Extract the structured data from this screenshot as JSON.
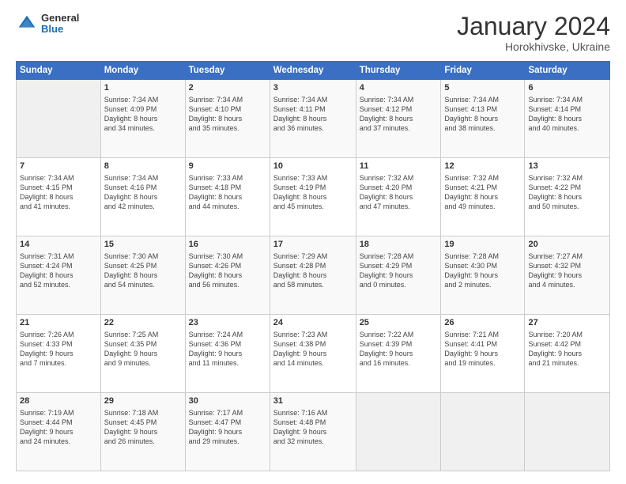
{
  "header": {
    "logo_line1": "General",
    "logo_line2": "Blue",
    "month": "January 2024",
    "location": "Horokhivske, Ukraine"
  },
  "days_of_week": [
    "Sunday",
    "Monday",
    "Tuesday",
    "Wednesday",
    "Thursday",
    "Friday",
    "Saturday"
  ],
  "weeks": [
    [
      {
        "day": "",
        "info": ""
      },
      {
        "day": "1",
        "info": "Sunrise: 7:34 AM\nSunset: 4:09 PM\nDaylight: 8 hours\nand 34 minutes."
      },
      {
        "day": "2",
        "info": "Sunrise: 7:34 AM\nSunset: 4:10 PM\nDaylight: 8 hours\nand 35 minutes."
      },
      {
        "day": "3",
        "info": "Sunrise: 7:34 AM\nSunset: 4:11 PM\nDaylight: 8 hours\nand 36 minutes."
      },
      {
        "day": "4",
        "info": "Sunrise: 7:34 AM\nSunset: 4:12 PM\nDaylight: 8 hours\nand 37 minutes."
      },
      {
        "day": "5",
        "info": "Sunrise: 7:34 AM\nSunset: 4:13 PM\nDaylight: 8 hours\nand 38 minutes."
      },
      {
        "day": "6",
        "info": "Sunrise: 7:34 AM\nSunset: 4:14 PM\nDaylight: 8 hours\nand 40 minutes."
      }
    ],
    [
      {
        "day": "7",
        "info": "Sunrise: 7:34 AM\nSunset: 4:15 PM\nDaylight: 8 hours\nand 41 minutes."
      },
      {
        "day": "8",
        "info": "Sunrise: 7:34 AM\nSunset: 4:16 PM\nDaylight: 8 hours\nand 42 minutes."
      },
      {
        "day": "9",
        "info": "Sunrise: 7:33 AM\nSunset: 4:18 PM\nDaylight: 8 hours\nand 44 minutes."
      },
      {
        "day": "10",
        "info": "Sunrise: 7:33 AM\nSunset: 4:19 PM\nDaylight: 8 hours\nand 45 minutes."
      },
      {
        "day": "11",
        "info": "Sunrise: 7:32 AM\nSunset: 4:20 PM\nDaylight: 8 hours\nand 47 minutes."
      },
      {
        "day": "12",
        "info": "Sunrise: 7:32 AM\nSunset: 4:21 PM\nDaylight: 8 hours\nand 49 minutes."
      },
      {
        "day": "13",
        "info": "Sunrise: 7:32 AM\nSunset: 4:22 PM\nDaylight: 8 hours\nand 50 minutes."
      }
    ],
    [
      {
        "day": "14",
        "info": "Sunrise: 7:31 AM\nSunset: 4:24 PM\nDaylight: 8 hours\nand 52 minutes."
      },
      {
        "day": "15",
        "info": "Sunrise: 7:30 AM\nSunset: 4:25 PM\nDaylight: 8 hours\nand 54 minutes."
      },
      {
        "day": "16",
        "info": "Sunrise: 7:30 AM\nSunset: 4:26 PM\nDaylight: 8 hours\nand 56 minutes."
      },
      {
        "day": "17",
        "info": "Sunrise: 7:29 AM\nSunset: 4:28 PM\nDaylight: 8 hours\nand 58 minutes."
      },
      {
        "day": "18",
        "info": "Sunrise: 7:28 AM\nSunset: 4:29 PM\nDaylight: 9 hours\nand 0 minutes."
      },
      {
        "day": "19",
        "info": "Sunrise: 7:28 AM\nSunset: 4:30 PM\nDaylight: 9 hours\nand 2 minutes."
      },
      {
        "day": "20",
        "info": "Sunrise: 7:27 AM\nSunset: 4:32 PM\nDaylight: 9 hours\nand 4 minutes."
      }
    ],
    [
      {
        "day": "21",
        "info": "Sunrise: 7:26 AM\nSunset: 4:33 PM\nDaylight: 9 hours\nand 7 minutes."
      },
      {
        "day": "22",
        "info": "Sunrise: 7:25 AM\nSunset: 4:35 PM\nDaylight: 9 hours\nand 9 minutes."
      },
      {
        "day": "23",
        "info": "Sunrise: 7:24 AM\nSunset: 4:36 PM\nDaylight: 9 hours\nand 11 minutes."
      },
      {
        "day": "24",
        "info": "Sunrise: 7:23 AM\nSunset: 4:38 PM\nDaylight: 9 hours\nand 14 minutes."
      },
      {
        "day": "25",
        "info": "Sunrise: 7:22 AM\nSunset: 4:39 PM\nDaylight: 9 hours\nand 16 minutes."
      },
      {
        "day": "26",
        "info": "Sunrise: 7:21 AM\nSunset: 4:41 PM\nDaylight: 9 hours\nand 19 minutes."
      },
      {
        "day": "27",
        "info": "Sunrise: 7:20 AM\nSunset: 4:42 PM\nDaylight: 9 hours\nand 21 minutes."
      }
    ],
    [
      {
        "day": "28",
        "info": "Sunrise: 7:19 AM\nSunset: 4:44 PM\nDaylight: 9 hours\nand 24 minutes."
      },
      {
        "day": "29",
        "info": "Sunrise: 7:18 AM\nSunset: 4:45 PM\nDaylight: 9 hours\nand 26 minutes."
      },
      {
        "day": "30",
        "info": "Sunrise: 7:17 AM\nSunset: 4:47 PM\nDaylight: 9 hours\nand 29 minutes."
      },
      {
        "day": "31",
        "info": "Sunrise: 7:16 AM\nSunset: 4:48 PM\nDaylight: 9 hours\nand 32 minutes."
      },
      {
        "day": "",
        "info": ""
      },
      {
        "day": "",
        "info": ""
      },
      {
        "day": "",
        "info": ""
      }
    ]
  ]
}
